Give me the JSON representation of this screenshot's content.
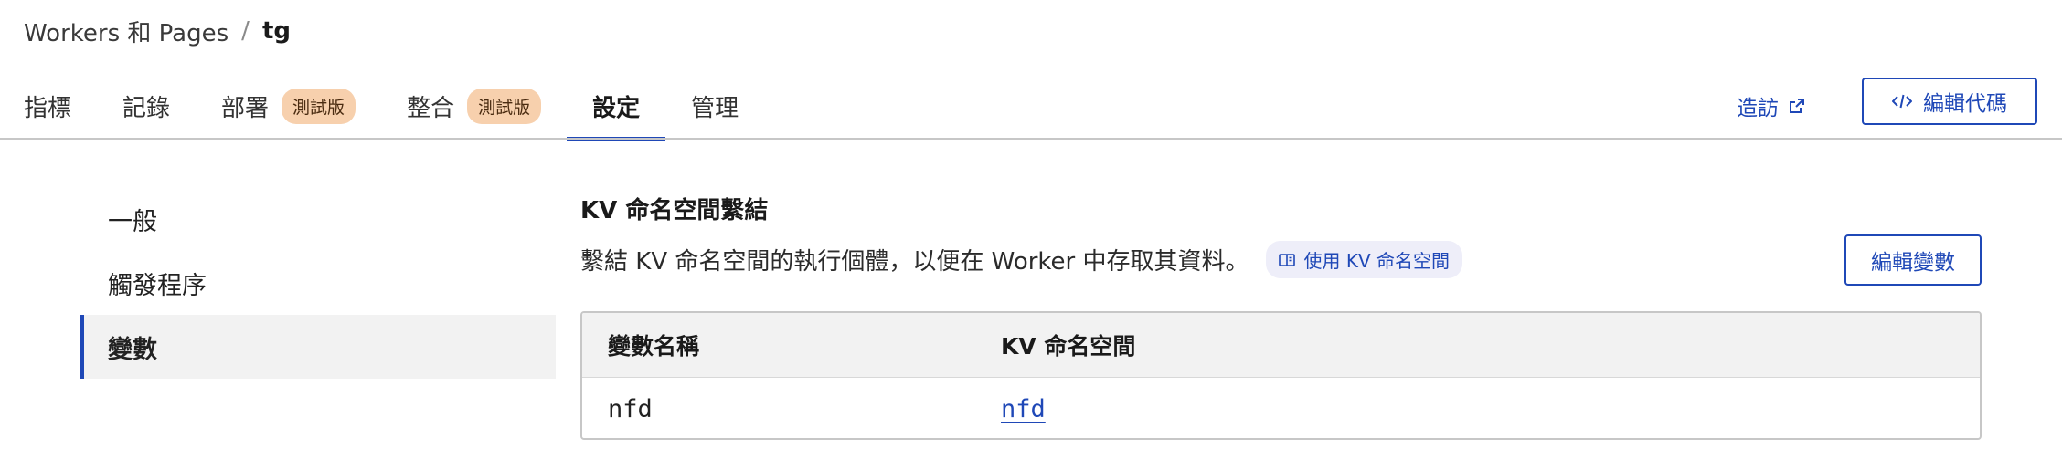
{
  "breadcrumb": {
    "parent": "Workers 和 Pages",
    "separator": "/",
    "current": "tg"
  },
  "tabs": [
    {
      "label": "指標"
    },
    {
      "label": "記錄"
    },
    {
      "label": "部署",
      "badge": "測試版"
    },
    {
      "label": "整合",
      "badge": "測試版"
    },
    {
      "label": "設定",
      "active": true
    },
    {
      "label": "管理"
    }
  ],
  "header_actions": {
    "visit_label": "造訪",
    "visit_icon": "external-link-icon",
    "edit_code_label": "編輯代碼",
    "edit_code_icon": "code-icon"
  },
  "sidebar": {
    "items": [
      {
        "label": "一般"
      },
      {
        "label": "觸發程序"
      },
      {
        "label": "變數",
        "active": true
      }
    ]
  },
  "section": {
    "title": "KV 命名空間繫結",
    "description": "繫結 KV 命名空間的執行個體，以便在 Worker 中存取其資料。",
    "doc_link_label": "使用 KV 命名空間",
    "doc_link_icon": "book-icon",
    "edit_button_label": "編輯變數"
  },
  "table": {
    "headers": [
      "變數名稱",
      "KV 命名空間"
    ],
    "rows": [
      {
        "variable": "nfd",
        "namespace": "nfd"
      }
    ]
  },
  "colors": {
    "accent": "#1f48b7",
    "badge_bg": "#f7d0ad",
    "chip_bg": "#eeeef9",
    "active_bg": "#f2f2f2"
  }
}
